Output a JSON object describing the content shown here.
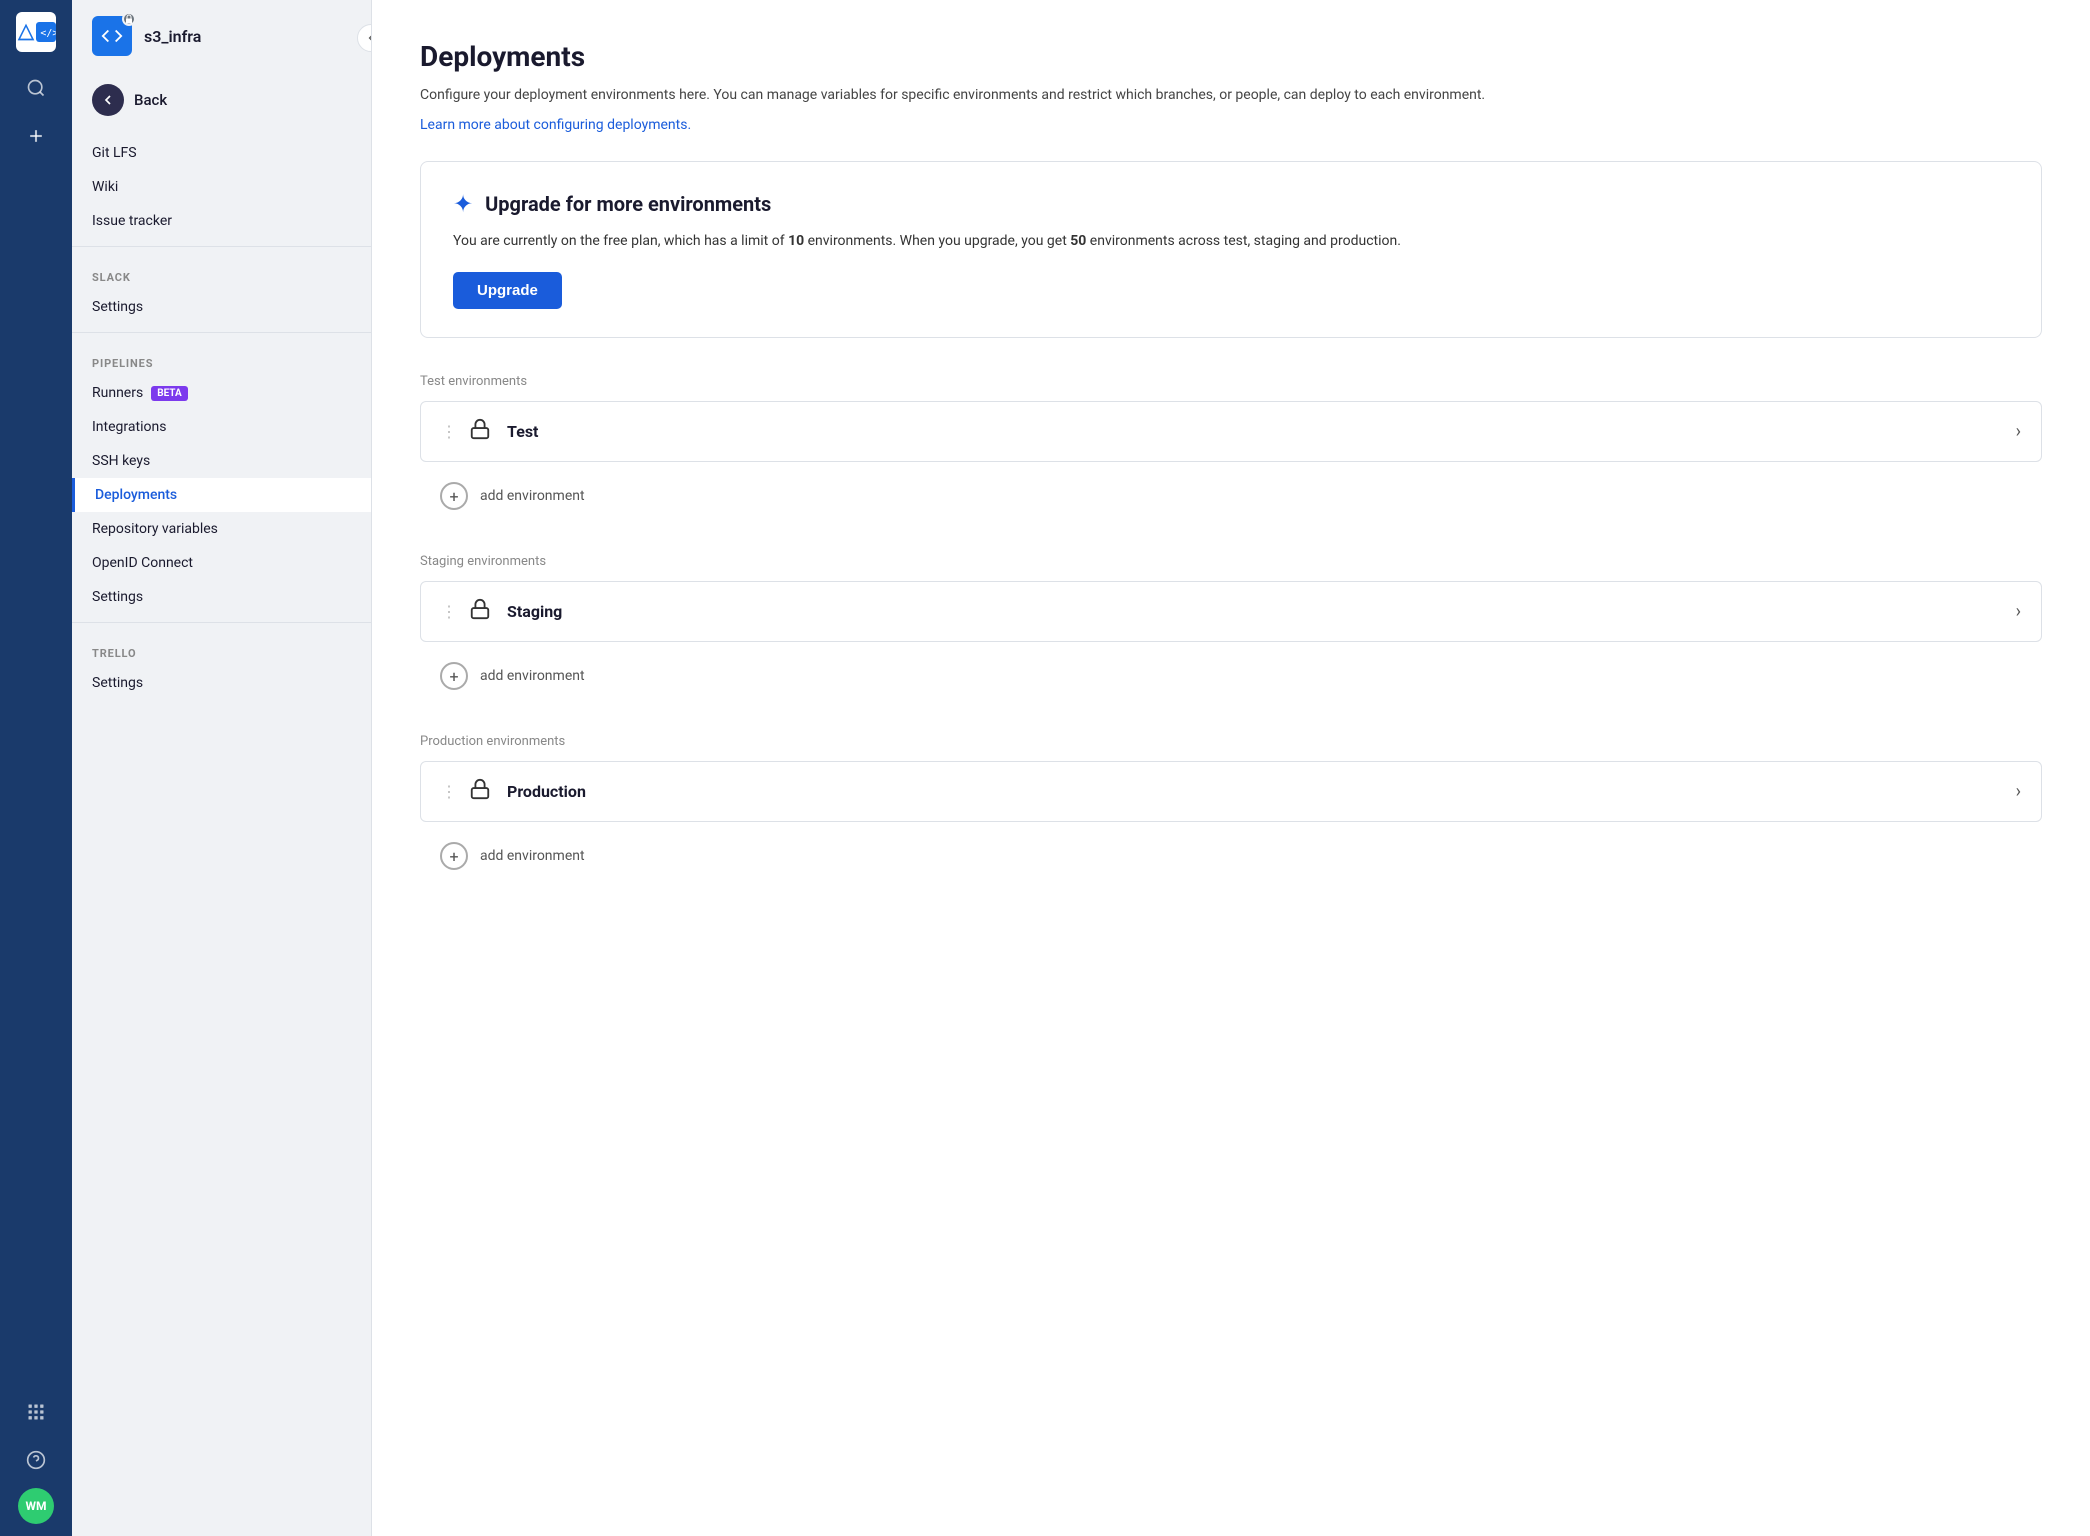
{
  "iconBar": {
    "logo": "bitbucket",
    "avatar": "WM",
    "avatarColor": "#2ecc71"
  },
  "sidebar": {
    "repoName": "s3_infra",
    "backLabel": "Back",
    "items": [
      {
        "id": "git-lfs",
        "label": "Git LFS",
        "active": false
      },
      {
        "id": "wiki",
        "label": "Wiki",
        "active": false
      },
      {
        "id": "issue-tracker",
        "label": "Issue tracker",
        "active": false
      }
    ],
    "sections": [
      {
        "id": "slack",
        "label": "SLACK",
        "items": [
          {
            "id": "slack-settings",
            "label": "Settings",
            "badge": null
          }
        ]
      },
      {
        "id": "pipelines",
        "label": "PIPELINES",
        "items": [
          {
            "id": "runners",
            "label": "Runners",
            "badge": "BETA"
          },
          {
            "id": "integrations",
            "label": "Integrations",
            "badge": null
          },
          {
            "id": "ssh-keys",
            "label": "SSH keys",
            "badge": null
          },
          {
            "id": "deployments",
            "label": "Deployments",
            "active": true,
            "badge": null
          },
          {
            "id": "repository-variables",
            "label": "Repository variables",
            "badge": null
          },
          {
            "id": "openid-connect",
            "label": "OpenID Connect",
            "badge": null
          },
          {
            "id": "pipelines-settings",
            "label": "Settings",
            "badge": null
          }
        ]
      },
      {
        "id": "trello",
        "label": "TRELLO",
        "items": [
          {
            "id": "trello-settings",
            "label": "Settings",
            "badge": null
          }
        ]
      }
    ]
  },
  "main": {
    "title": "Deployments",
    "description": "Configure your deployment environments here. You can manage variables for specific environments and restrict which branches, or people, can deploy to each environment.",
    "learnMoreLink": "Learn more about configuring deployments.",
    "upgradeCard": {
      "title": "Upgrade for more environments",
      "description": "You are currently on the free plan, which has a limit of 10 environments. When you upgrade, you get 50 environments across test, staging and production.",
      "limitNumber": "10",
      "upgradeNumber": "50",
      "buttonLabel": "Upgrade"
    },
    "environmentSections": [
      {
        "id": "test",
        "label": "Test environments",
        "environments": [
          {
            "id": "test-env",
            "name": "Test"
          }
        ],
        "addLabel": "add environment"
      },
      {
        "id": "staging",
        "label": "Staging environments",
        "environments": [
          {
            "id": "staging-env",
            "name": "Staging"
          }
        ],
        "addLabel": "add environment"
      },
      {
        "id": "production",
        "label": "Production environments",
        "environments": [
          {
            "id": "production-env",
            "name": "Production"
          }
        ],
        "addLabel": "add environment"
      }
    ]
  }
}
